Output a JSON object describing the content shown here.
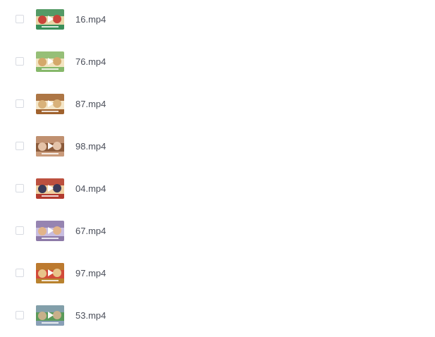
{
  "files": [
    {
      "name": "16.mp4",
      "thumb_icon": "video-thumbnail-icon",
      "thumb_colors": [
        "#3a8f5a",
        "#c9453a",
        "#e8d7a8"
      ]
    },
    {
      "name": "76.mp4",
      "thumb_icon": "video-thumbnail-icon",
      "thumb_colors": [
        "#86b86a",
        "#d4a86a",
        "#f2e4c0"
      ]
    },
    {
      "name": "87.mp4",
      "thumb_icon": "video-thumbnail-icon",
      "thumb_colors": [
        "#a0622e",
        "#d9b27a",
        "#f4e6c8"
      ]
    },
    {
      "name": "98.mp4",
      "thumb_icon": "video-thumbnail-icon",
      "thumb_colors": [
        "#c99a7a",
        "#e5c3a8",
        "#8a5a3a"
      ]
    },
    {
      "name": "04.mp4",
      "thumb_icon": "video-thumbnail-icon",
      "thumb_colors": [
        "#b33a2e",
        "#3a3a58",
        "#f0d0a0"
      ]
    },
    {
      "name": "67.mp4",
      "thumb_icon": "video-thumbnail-icon",
      "thumb_colors": [
        "#8d7aa8",
        "#e2b48a",
        "#c8bde0"
      ]
    },
    {
      "name": "97.mp4",
      "thumb_icon": "video-thumbnail-icon",
      "thumb_colors": [
        "#b9822e",
        "#e8c48a",
        "#d24a3a"
      ]
    },
    {
      "name": "53.mp4",
      "thumb_icon": "video-thumbnail-icon",
      "thumb_colors": [
        "#8aa0b8",
        "#c8b08a",
        "#5a9a5a"
      ]
    }
  ],
  "colors": {
    "filename_text": "#4b4f5a",
    "checkbox_border": "#d8dbe2"
  }
}
